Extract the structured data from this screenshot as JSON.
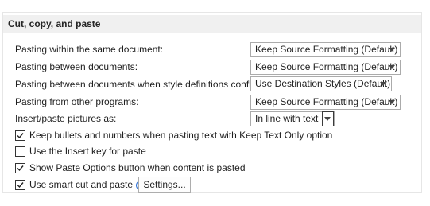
{
  "section": {
    "title": "Cut, copy, and paste"
  },
  "dropdown_rows": [
    {
      "label": "Pasting within the same document:",
      "value": "Keep Source Formatting (Default)"
    },
    {
      "label": "Pasting between documents:",
      "value": "Keep Source Formatting (Default)"
    },
    {
      "label": "Pasting between documents when style definitions conflict:",
      "value": "Use Destination Styles (Default)"
    },
    {
      "label": "Pasting from other programs:",
      "value": "Keep Source Formatting (Default)"
    },
    {
      "label": "Insert/paste pictures as:",
      "value": "In line with text"
    }
  ],
  "checkboxes": [
    {
      "label": "Keep bullets and numbers when pasting text with Keep Text Only option",
      "checked": true
    },
    {
      "label": "Use the Insert key for paste",
      "checked": false
    },
    {
      "label": "Show Paste Options button when content is pasted",
      "checked": true
    },
    {
      "label": "Use smart cut and paste",
      "checked": true
    }
  ],
  "settings_button": {
    "label": "Settings..."
  },
  "icons": {
    "info": "info-icon",
    "dropdown": "chevron-down-icon",
    "check": "checkmark-icon"
  }
}
